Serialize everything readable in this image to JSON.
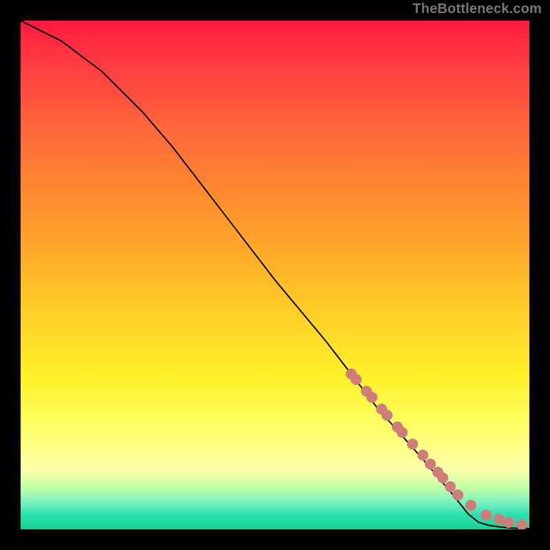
{
  "watermark": "TheBottleneck.com",
  "plot": {
    "widthPx": 740,
    "heightPx": 740,
    "lineColor": "#000000",
    "dotColor": "#cf7d7a"
  },
  "chart_data": {
    "type": "line",
    "title": "",
    "xlabel": "",
    "ylabel": "",
    "xlim": [
      0,
      100
    ],
    "ylim": [
      0,
      100
    ],
    "grid": false,
    "series": [
      {
        "name": "curve",
        "x": [
          0,
          4,
          8,
          12,
          16,
          20,
          24,
          30,
          40,
          50,
          60,
          70,
          78,
          84,
          88,
          90,
          92,
          94,
          96,
          98,
          100
        ],
        "y": [
          100,
          98,
          96,
          93,
          90,
          86,
          82,
          75,
          62,
          49,
          37,
          24,
          15,
          8,
          3,
          1.4,
          0.8,
          0.5,
          0.3,
          0.2,
          0.15
        ]
      }
    ],
    "scatter": [
      {
        "name": "marked-points",
        "note": "pink dotted markers on curve",
        "x": [
          65,
          66,
          68,
          69,
          71,
          72,
          74,
          75,
          77,
          79,
          80.5,
          82,
          83,
          84.5,
          86,
          88.5,
          91.5,
          94,
          96,
          98.5
        ],
        "y": [
          30.6,
          29.4,
          27.1,
          25.9,
          23.7,
          22.5,
          20.2,
          19.1,
          16.8,
          14.6,
          12.9,
          11.2,
          10.1,
          8.4,
          6.8,
          4.7,
          2.9,
          2.0,
          1.4,
          1.0
        ]
      }
    ]
  }
}
